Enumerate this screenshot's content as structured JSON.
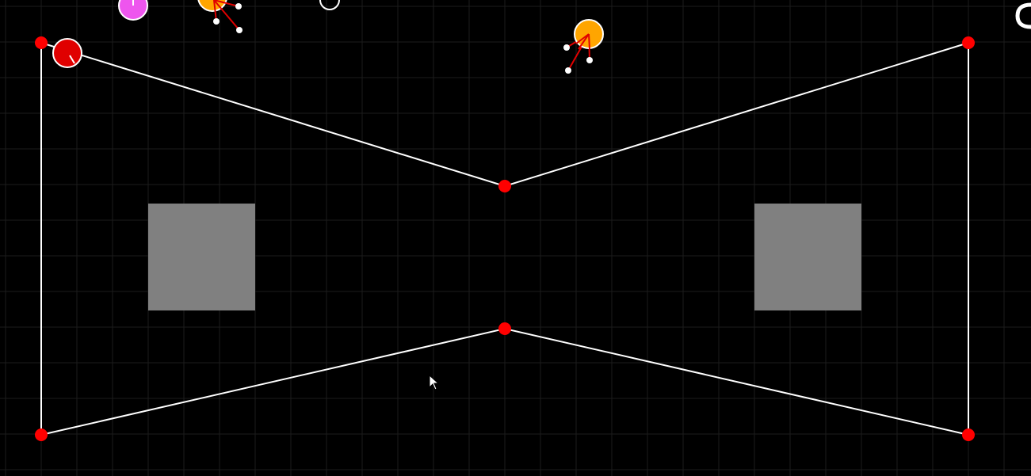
{
  "colors": {
    "background": "#000000",
    "grid": "#1c1c1c",
    "wall": "#ffffff",
    "vertex": "#ff0000",
    "obstacle": "#808080",
    "player": "#e00000",
    "enemy_orange": "#ffa500",
    "enemy_pink": "#ee55ee",
    "aim_line": "#e00000"
  },
  "arena": {
    "shape": "bowtie",
    "vertex_count": 6,
    "obstacle_count": 2
  },
  "entities": {
    "player": {
      "color": "red",
      "icon": "player-ball-icon"
    },
    "enemies": [
      {
        "color": "orange",
        "icon": "enemy-ball-icon"
      },
      {
        "color": "orange",
        "icon": "enemy-ball-icon"
      },
      {
        "color": "pink",
        "icon": "enemy-ball-icon"
      }
    ]
  },
  "cursor": {
    "icon": "mouse-pointer-icon"
  }
}
